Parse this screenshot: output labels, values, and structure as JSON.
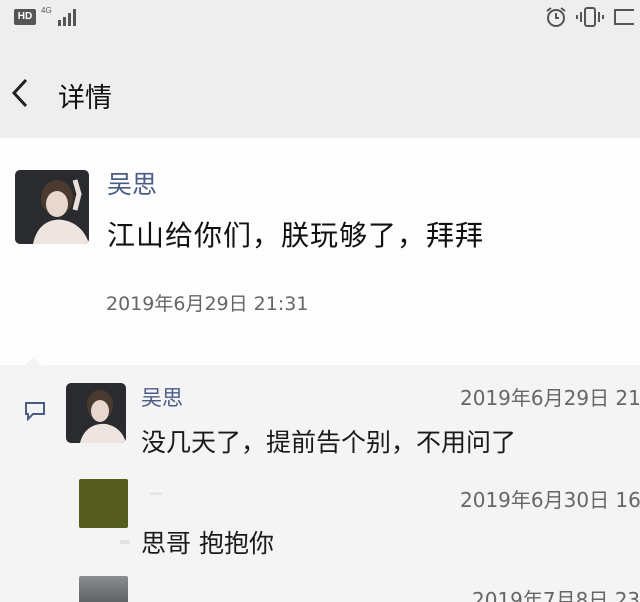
{
  "status_bar": {
    "hd_label": "HD",
    "network_label": "4G",
    "icons": [
      "signal-icon",
      "alarm-icon",
      "vibrate-icon",
      "battery-icon"
    ]
  },
  "header": {
    "back_icon": "chevron-left-icon",
    "title": "详情"
  },
  "post": {
    "author": "吴思",
    "text": "江山给你们，朕玩够了，拜拜",
    "time": "2019年6月29日 21:31"
  },
  "comments": {
    "icon": "comment-icon",
    "items": [
      {
        "author": "吴思",
        "time": "2019年6月29日 21",
        "text": "没几天了，提前告个别，不用问了"
      },
      {
        "author": "",
        "time": "2019年6月30日 16",
        "text": "思哥 抱抱你"
      },
      {
        "author": "",
        "time": "2019年7月8日 23",
        "text": ""
      }
    ]
  },
  "colors": {
    "name_link": "#4a5b84",
    "header_bg": "#eeeeee",
    "comment_bg": "#f4f4f4"
  }
}
